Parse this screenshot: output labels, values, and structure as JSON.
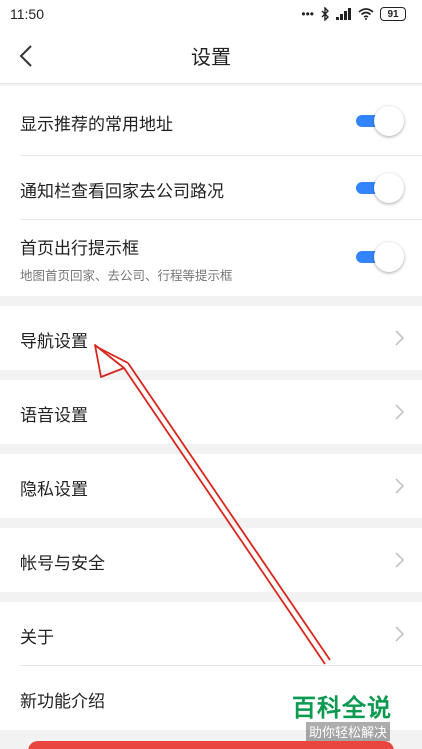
{
  "status_bar": {
    "time": "11:50",
    "signal_text": "•••",
    "battery": "91"
  },
  "header": {
    "title": "设置"
  },
  "toggles": [
    {
      "title": "显示推荐的常用地址",
      "on": true
    },
    {
      "title": "通知栏查看回家去公司路况",
      "on": true
    },
    {
      "title": "首页出行提示框",
      "subtitle": "地图首页回家、去公司、行程等提示框",
      "on": true
    }
  ],
  "menu": {
    "navigation": "导航设置",
    "voice": "语音设置",
    "privacy": "隐私设置",
    "account": "帐号与安全",
    "about": "关于",
    "new_features": "新功能介绍"
  },
  "watermark": {
    "main": "百科全说",
    "sub": "助你轻松解决"
  },
  "colors": {
    "accent": "#3385ff",
    "annotation": "#d9261c",
    "watermark": "#0a9a4f",
    "button": "#e8463e"
  }
}
